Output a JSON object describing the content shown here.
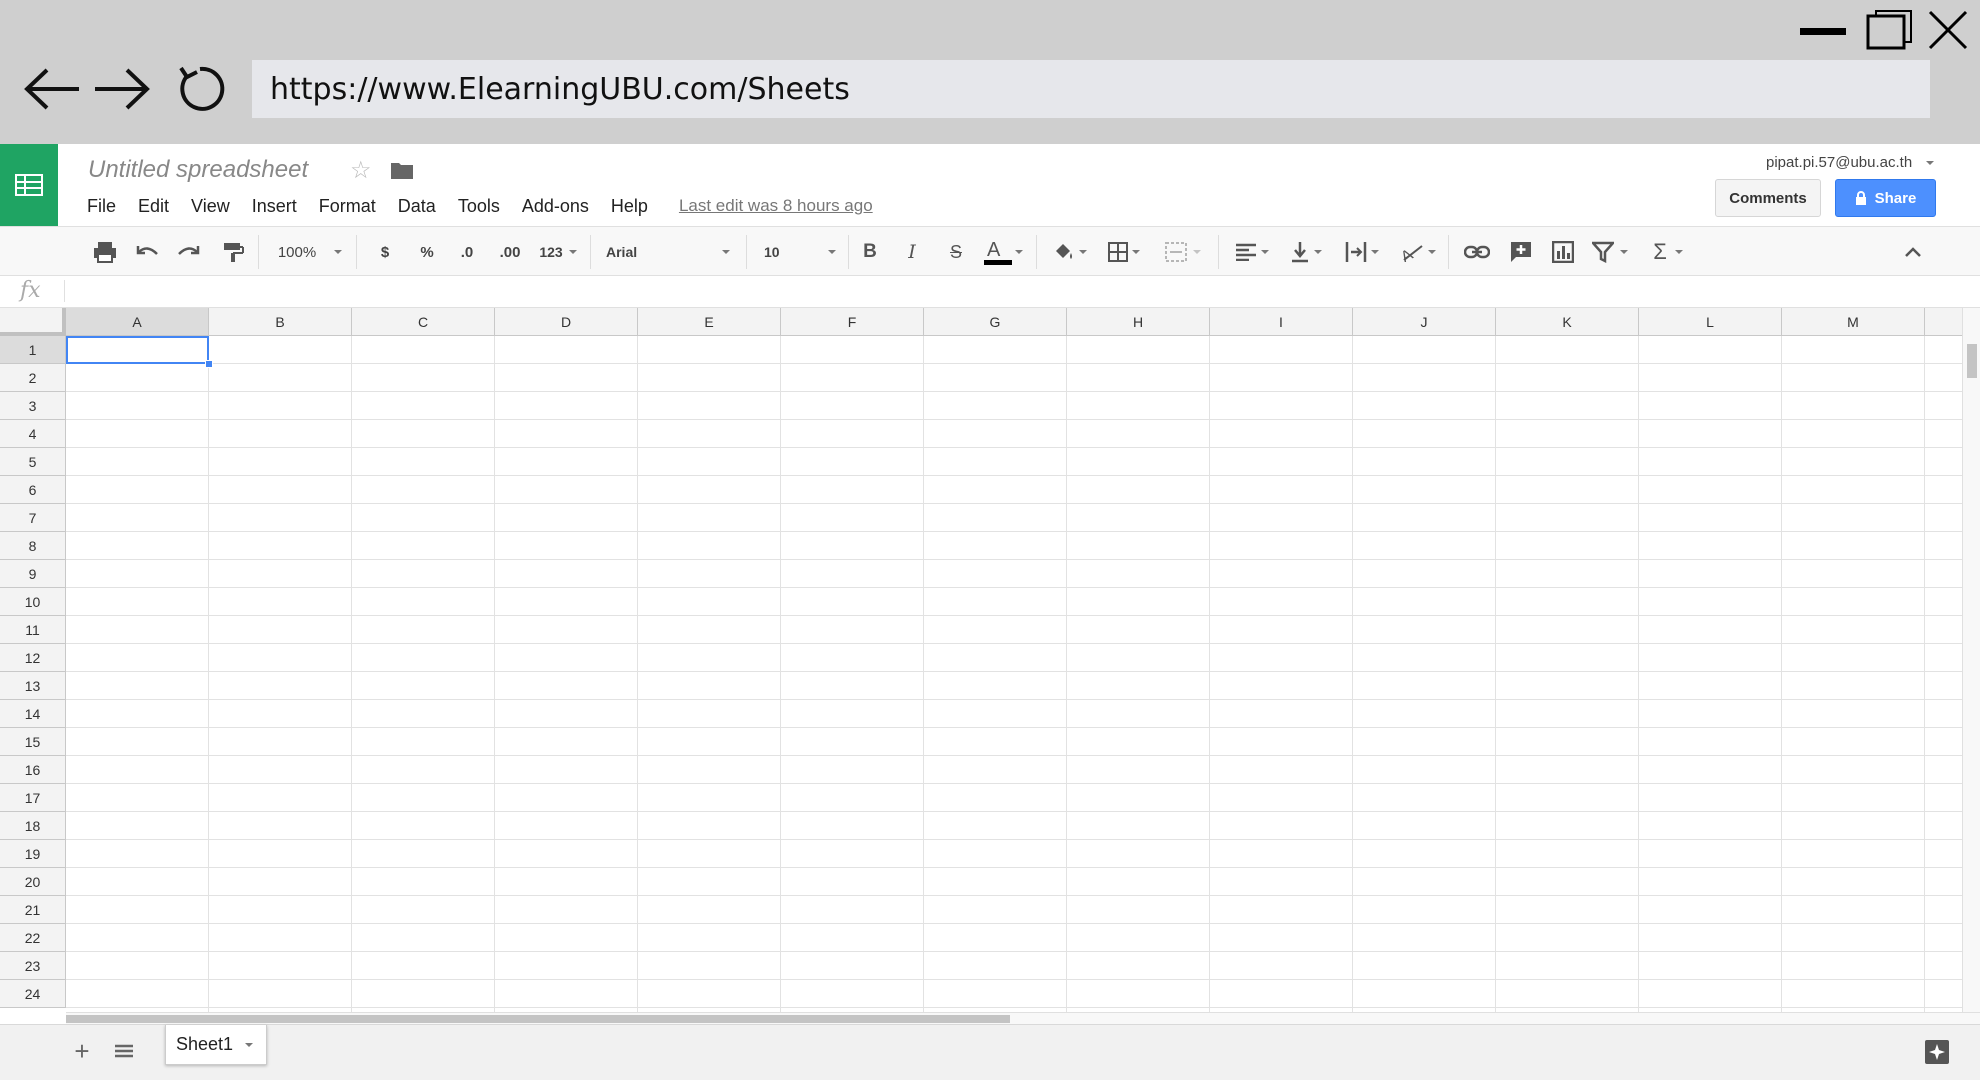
{
  "browser": {
    "url": "https://www.ElearningUBU.com/Sheets"
  },
  "header": {
    "title": "Untitled spreadsheet",
    "account": "pipat.pi.57@ubu.ac.th",
    "comments_label": "Comments",
    "share_label": "Share",
    "last_edit": "Last edit was 8 hours ago"
  },
  "menu": {
    "items": [
      "File",
      "Edit",
      "View",
      "Insert",
      "Format",
      "Data",
      "Tools",
      "Add-ons",
      "Help"
    ]
  },
  "toolbar": {
    "zoom": "100%",
    "currency": "$",
    "percent": "%",
    "decrease_decimal": ".0",
    "increase_decimal": ".00",
    "more_formats": "123",
    "font": "Arial",
    "font_size": "10"
  },
  "formula_bar": {
    "fx_label": "fx",
    "value": ""
  },
  "grid": {
    "columns": [
      "A",
      "B",
      "C",
      "D",
      "E",
      "F",
      "G",
      "H",
      "I",
      "J",
      "K",
      "L",
      "M"
    ],
    "rows": [
      "1",
      "2",
      "3",
      "4",
      "5",
      "6",
      "7",
      "8",
      "9",
      "10",
      "11",
      "12",
      "13",
      "14",
      "15",
      "16",
      "17",
      "18",
      "19",
      "20",
      "21",
      "22",
      "23",
      "24"
    ],
    "selected_cell": "A1"
  },
  "sheets": {
    "tabs": [
      "Sheet1"
    ]
  },
  "colors": {
    "brand_green": "#1fa463",
    "share_blue": "#4d90fe",
    "selection_blue": "#4285f4"
  }
}
